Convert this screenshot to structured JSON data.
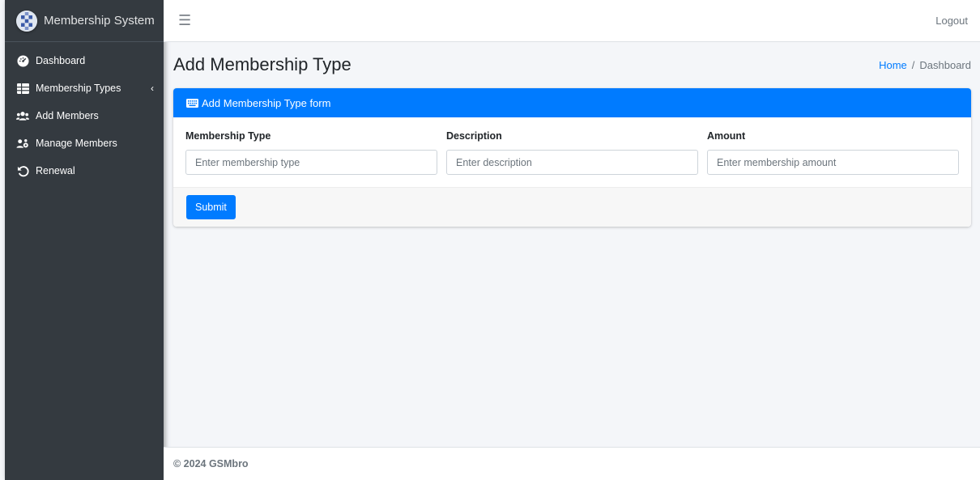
{
  "brand": {
    "title": "Membership System"
  },
  "sidebar": {
    "items": [
      {
        "label": "Dashboard",
        "icon": "tachometer-icon"
      },
      {
        "label": "Membership Types",
        "icon": "table-icon",
        "caret": "‹"
      },
      {
        "label": "Add Members",
        "icon": "users-icon"
      },
      {
        "label": "Manage Members",
        "icon": "users-cog-icon"
      },
      {
        "label": "Renewal",
        "icon": "undo-icon"
      }
    ]
  },
  "topbar": {
    "menu_icon": "☰",
    "logout_label": "Logout"
  },
  "header": {
    "title": "Add Membership Type",
    "breadcrumb": {
      "home": "Home",
      "separator": "/",
      "current": "Dashboard"
    }
  },
  "form": {
    "title": "Add Membership Type form",
    "fields": [
      {
        "label": "Membership Type",
        "placeholder": "Enter membership type",
        "value": ""
      },
      {
        "label": "Description",
        "placeholder": "Enter description",
        "value": ""
      },
      {
        "label": "Amount",
        "placeholder": "Enter membership amount",
        "value": ""
      }
    ],
    "submit_label": "Submit"
  },
  "footer": {
    "text": "© 2024 GSMbro"
  },
  "colors": {
    "sidebar_bg": "#343a40",
    "primary": "#007bff",
    "content_bg": "#f4f6f9"
  }
}
